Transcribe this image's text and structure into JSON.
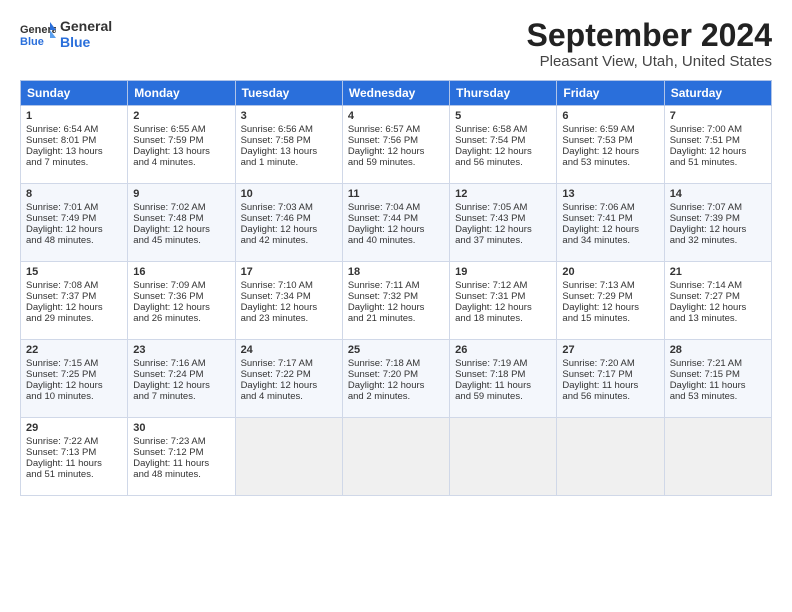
{
  "header": {
    "logo_general": "General",
    "logo_blue": "Blue",
    "month_title": "September 2024",
    "location": "Pleasant View, Utah, United States"
  },
  "days_of_week": [
    "Sunday",
    "Monday",
    "Tuesday",
    "Wednesday",
    "Thursday",
    "Friday",
    "Saturday"
  ],
  "weeks": [
    [
      {
        "day": "1",
        "lines": [
          "Sunrise: 6:54 AM",
          "Sunset: 8:01 PM",
          "Daylight: 13 hours",
          "and 7 minutes."
        ]
      },
      {
        "day": "2",
        "lines": [
          "Sunrise: 6:55 AM",
          "Sunset: 7:59 PM",
          "Daylight: 13 hours",
          "and 4 minutes."
        ]
      },
      {
        "day": "3",
        "lines": [
          "Sunrise: 6:56 AM",
          "Sunset: 7:58 PM",
          "Daylight: 13 hours",
          "and 1 minute."
        ]
      },
      {
        "day": "4",
        "lines": [
          "Sunrise: 6:57 AM",
          "Sunset: 7:56 PM",
          "Daylight: 12 hours",
          "and 59 minutes."
        ]
      },
      {
        "day": "5",
        "lines": [
          "Sunrise: 6:58 AM",
          "Sunset: 7:54 PM",
          "Daylight: 12 hours",
          "and 56 minutes."
        ]
      },
      {
        "day": "6",
        "lines": [
          "Sunrise: 6:59 AM",
          "Sunset: 7:53 PM",
          "Daylight: 12 hours",
          "and 53 minutes."
        ]
      },
      {
        "day": "7",
        "lines": [
          "Sunrise: 7:00 AM",
          "Sunset: 7:51 PM",
          "Daylight: 12 hours",
          "and 51 minutes."
        ]
      }
    ],
    [
      {
        "day": "8",
        "lines": [
          "Sunrise: 7:01 AM",
          "Sunset: 7:49 PM",
          "Daylight: 12 hours",
          "and 48 minutes."
        ]
      },
      {
        "day": "9",
        "lines": [
          "Sunrise: 7:02 AM",
          "Sunset: 7:48 PM",
          "Daylight: 12 hours",
          "and 45 minutes."
        ]
      },
      {
        "day": "10",
        "lines": [
          "Sunrise: 7:03 AM",
          "Sunset: 7:46 PM",
          "Daylight: 12 hours",
          "and 42 minutes."
        ]
      },
      {
        "day": "11",
        "lines": [
          "Sunrise: 7:04 AM",
          "Sunset: 7:44 PM",
          "Daylight: 12 hours",
          "and 40 minutes."
        ]
      },
      {
        "day": "12",
        "lines": [
          "Sunrise: 7:05 AM",
          "Sunset: 7:43 PM",
          "Daylight: 12 hours",
          "and 37 minutes."
        ]
      },
      {
        "day": "13",
        "lines": [
          "Sunrise: 7:06 AM",
          "Sunset: 7:41 PM",
          "Daylight: 12 hours",
          "and 34 minutes."
        ]
      },
      {
        "day": "14",
        "lines": [
          "Sunrise: 7:07 AM",
          "Sunset: 7:39 PM",
          "Daylight: 12 hours",
          "and 32 minutes."
        ]
      }
    ],
    [
      {
        "day": "15",
        "lines": [
          "Sunrise: 7:08 AM",
          "Sunset: 7:37 PM",
          "Daylight: 12 hours",
          "and 29 minutes."
        ]
      },
      {
        "day": "16",
        "lines": [
          "Sunrise: 7:09 AM",
          "Sunset: 7:36 PM",
          "Daylight: 12 hours",
          "and 26 minutes."
        ]
      },
      {
        "day": "17",
        "lines": [
          "Sunrise: 7:10 AM",
          "Sunset: 7:34 PM",
          "Daylight: 12 hours",
          "and 23 minutes."
        ]
      },
      {
        "day": "18",
        "lines": [
          "Sunrise: 7:11 AM",
          "Sunset: 7:32 PM",
          "Daylight: 12 hours",
          "and 21 minutes."
        ]
      },
      {
        "day": "19",
        "lines": [
          "Sunrise: 7:12 AM",
          "Sunset: 7:31 PM",
          "Daylight: 12 hours",
          "and 18 minutes."
        ]
      },
      {
        "day": "20",
        "lines": [
          "Sunrise: 7:13 AM",
          "Sunset: 7:29 PM",
          "Daylight: 12 hours",
          "and 15 minutes."
        ]
      },
      {
        "day": "21",
        "lines": [
          "Sunrise: 7:14 AM",
          "Sunset: 7:27 PM",
          "Daylight: 12 hours",
          "and 13 minutes."
        ]
      }
    ],
    [
      {
        "day": "22",
        "lines": [
          "Sunrise: 7:15 AM",
          "Sunset: 7:25 PM",
          "Daylight: 12 hours",
          "and 10 minutes."
        ]
      },
      {
        "day": "23",
        "lines": [
          "Sunrise: 7:16 AM",
          "Sunset: 7:24 PM",
          "Daylight: 12 hours",
          "and 7 minutes."
        ]
      },
      {
        "day": "24",
        "lines": [
          "Sunrise: 7:17 AM",
          "Sunset: 7:22 PM",
          "Daylight: 12 hours",
          "and 4 minutes."
        ]
      },
      {
        "day": "25",
        "lines": [
          "Sunrise: 7:18 AM",
          "Sunset: 7:20 PM",
          "Daylight: 12 hours",
          "and 2 minutes."
        ]
      },
      {
        "day": "26",
        "lines": [
          "Sunrise: 7:19 AM",
          "Sunset: 7:18 PM",
          "Daylight: 11 hours",
          "and 59 minutes."
        ]
      },
      {
        "day": "27",
        "lines": [
          "Sunrise: 7:20 AM",
          "Sunset: 7:17 PM",
          "Daylight: 11 hours",
          "and 56 minutes."
        ]
      },
      {
        "day": "28",
        "lines": [
          "Sunrise: 7:21 AM",
          "Sunset: 7:15 PM",
          "Daylight: 11 hours",
          "and 53 minutes."
        ]
      }
    ],
    [
      {
        "day": "29",
        "lines": [
          "Sunrise: 7:22 AM",
          "Sunset: 7:13 PM",
          "Daylight: 11 hours",
          "and 51 minutes."
        ]
      },
      {
        "day": "30",
        "lines": [
          "Sunrise: 7:23 AM",
          "Sunset: 7:12 PM",
          "Daylight: 11 hours",
          "and 48 minutes."
        ]
      },
      {
        "day": "",
        "lines": []
      },
      {
        "day": "",
        "lines": []
      },
      {
        "day": "",
        "lines": []
      },
      {
        "day": "",
        "lines": []
      },
      {
        "day": "",
        "lines": []
      }
    ]
  ]
}
